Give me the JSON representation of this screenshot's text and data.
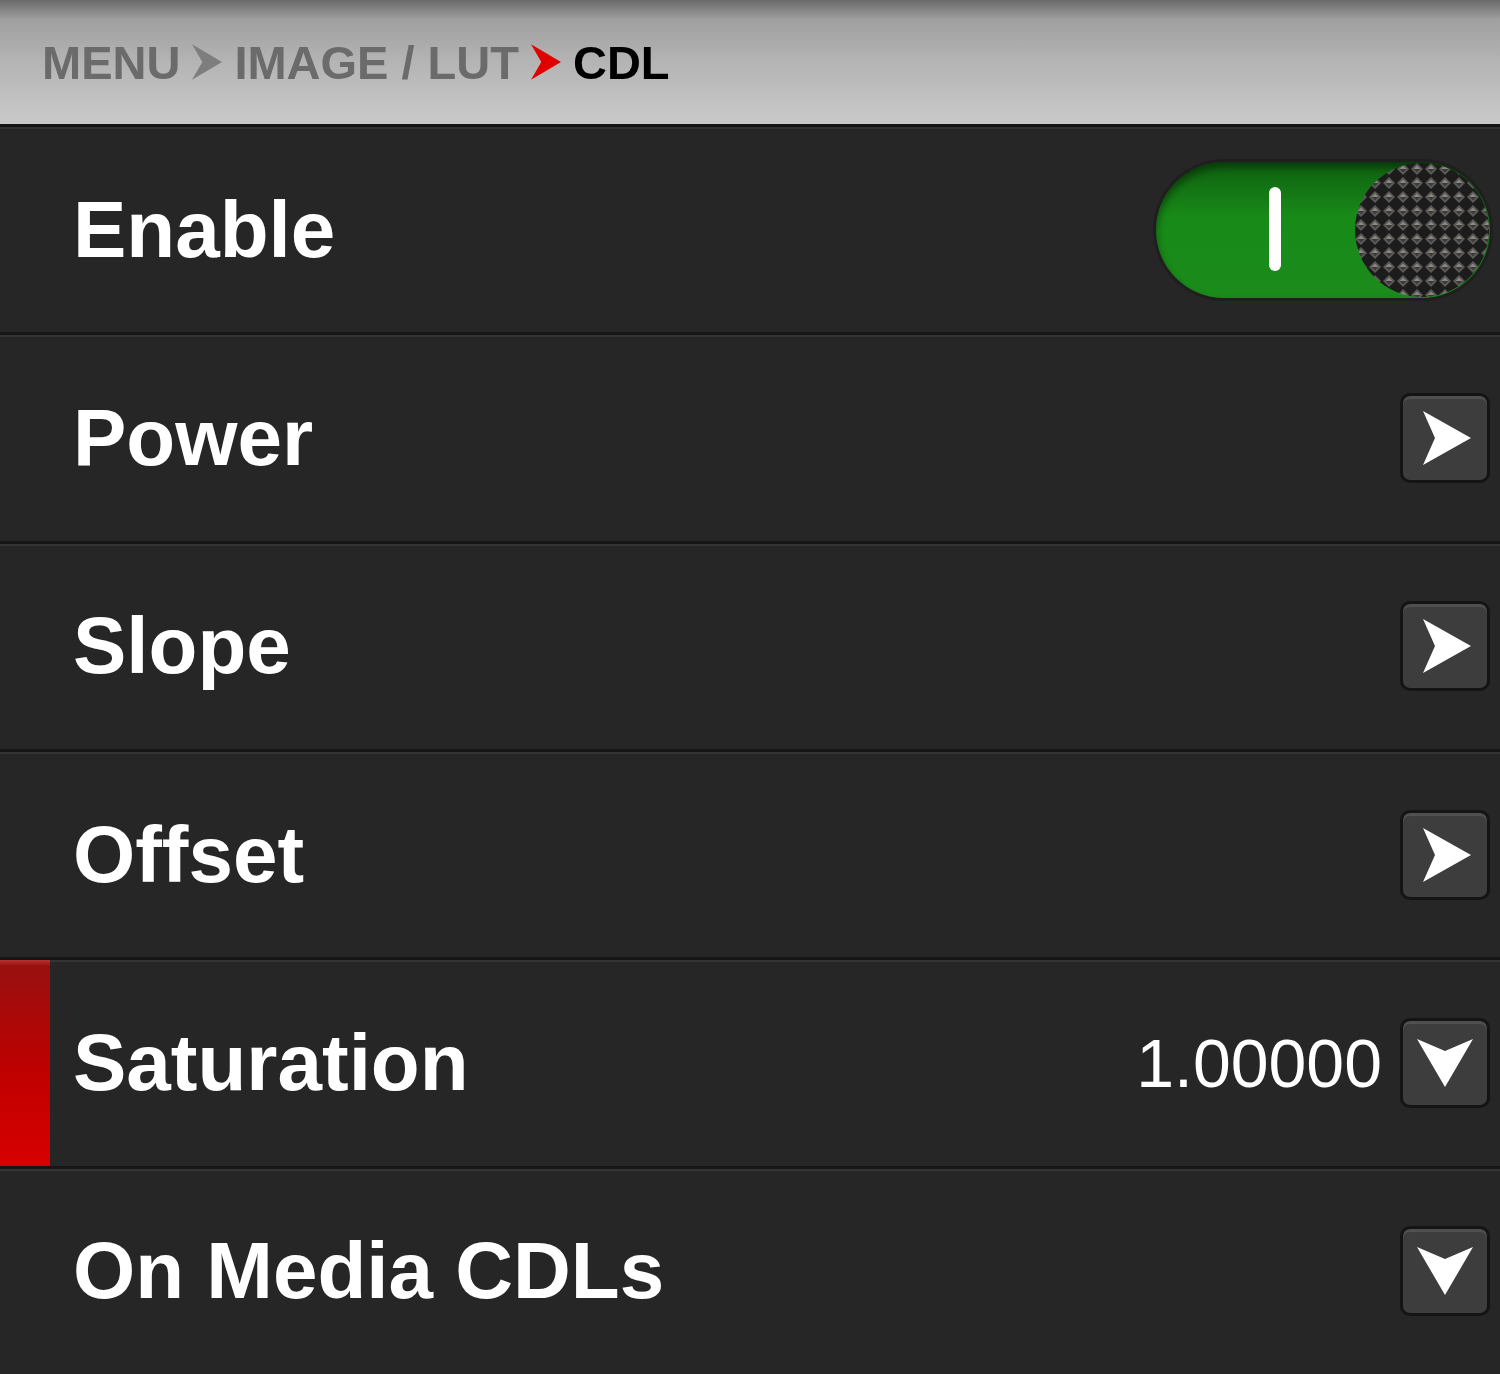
{
  "breadcrumb": [
    {
      "label": "MENU",
      "current": false
    },
    {
      "label": "IMAGE / LUT",
      "current": false
    },
    {
      "label": "CDL",
      "current": true
    }
  ],
  "rows": [
    {
      "kind": "toggle",
      "label": "Enable",
      "on": true,
      "selected": false
    },
    {
      "kind": "submenu",
      "label": "Power",
      "selected": false
    },
    {
      "kind": "submenu",
      "label": "Slope",
      "selected": false
    },
    {
      "kind": "submenu",
      "label": "Offset",
      "selected": false
    },
    {
      "kind": "dropdown",
      "label": "Saturation",
      "value": "1.00000",
      "selected": true
    },
    {
      "kind": "dropdown",
      "label": "On Media CDLs",
      "selected": false
    }
  ]
}
